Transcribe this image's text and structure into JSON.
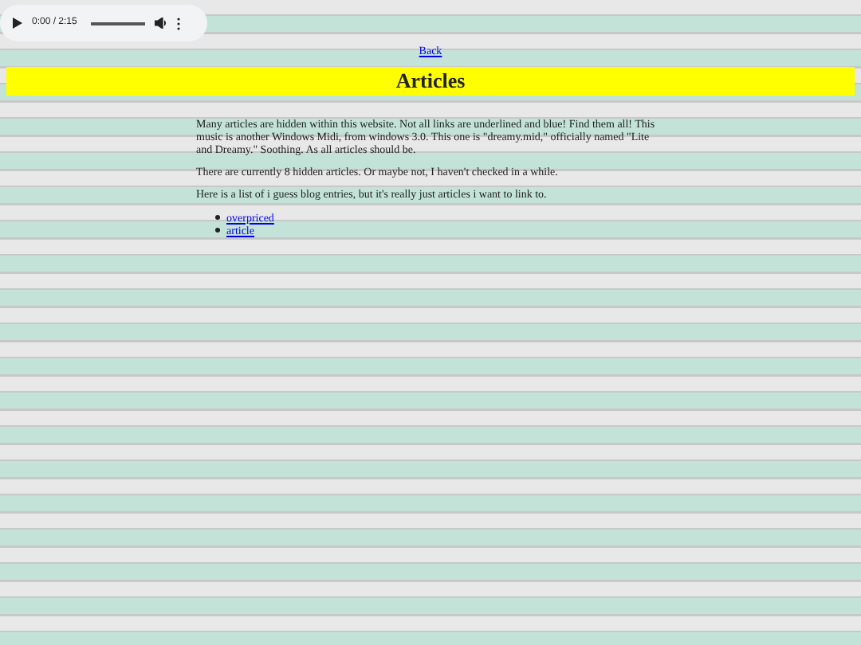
{
  "audio_player": {
    "time": "0:00 / 2:15"
  },
  "back_link": "Back",
  "heading": "Articles",
  "paragraphs": [
    "Many articles are hidden within this website. Not all links are underlined and blue! Find them all! This music is another Windows Midi, from windows 3.0. This one is \"dreamy.mid,\" officially named \"Lite and Dreamy.\" Soothing. As all articles should be.",
    "There are currently 8 hidden articles. Or maybe not, I haven't checked in a while.",
    "Here is a list of i guess blog entries, but it's really just articles i want to link to."
  ],
  "links": [
    "overpriced",
    "article"
  ]
}
